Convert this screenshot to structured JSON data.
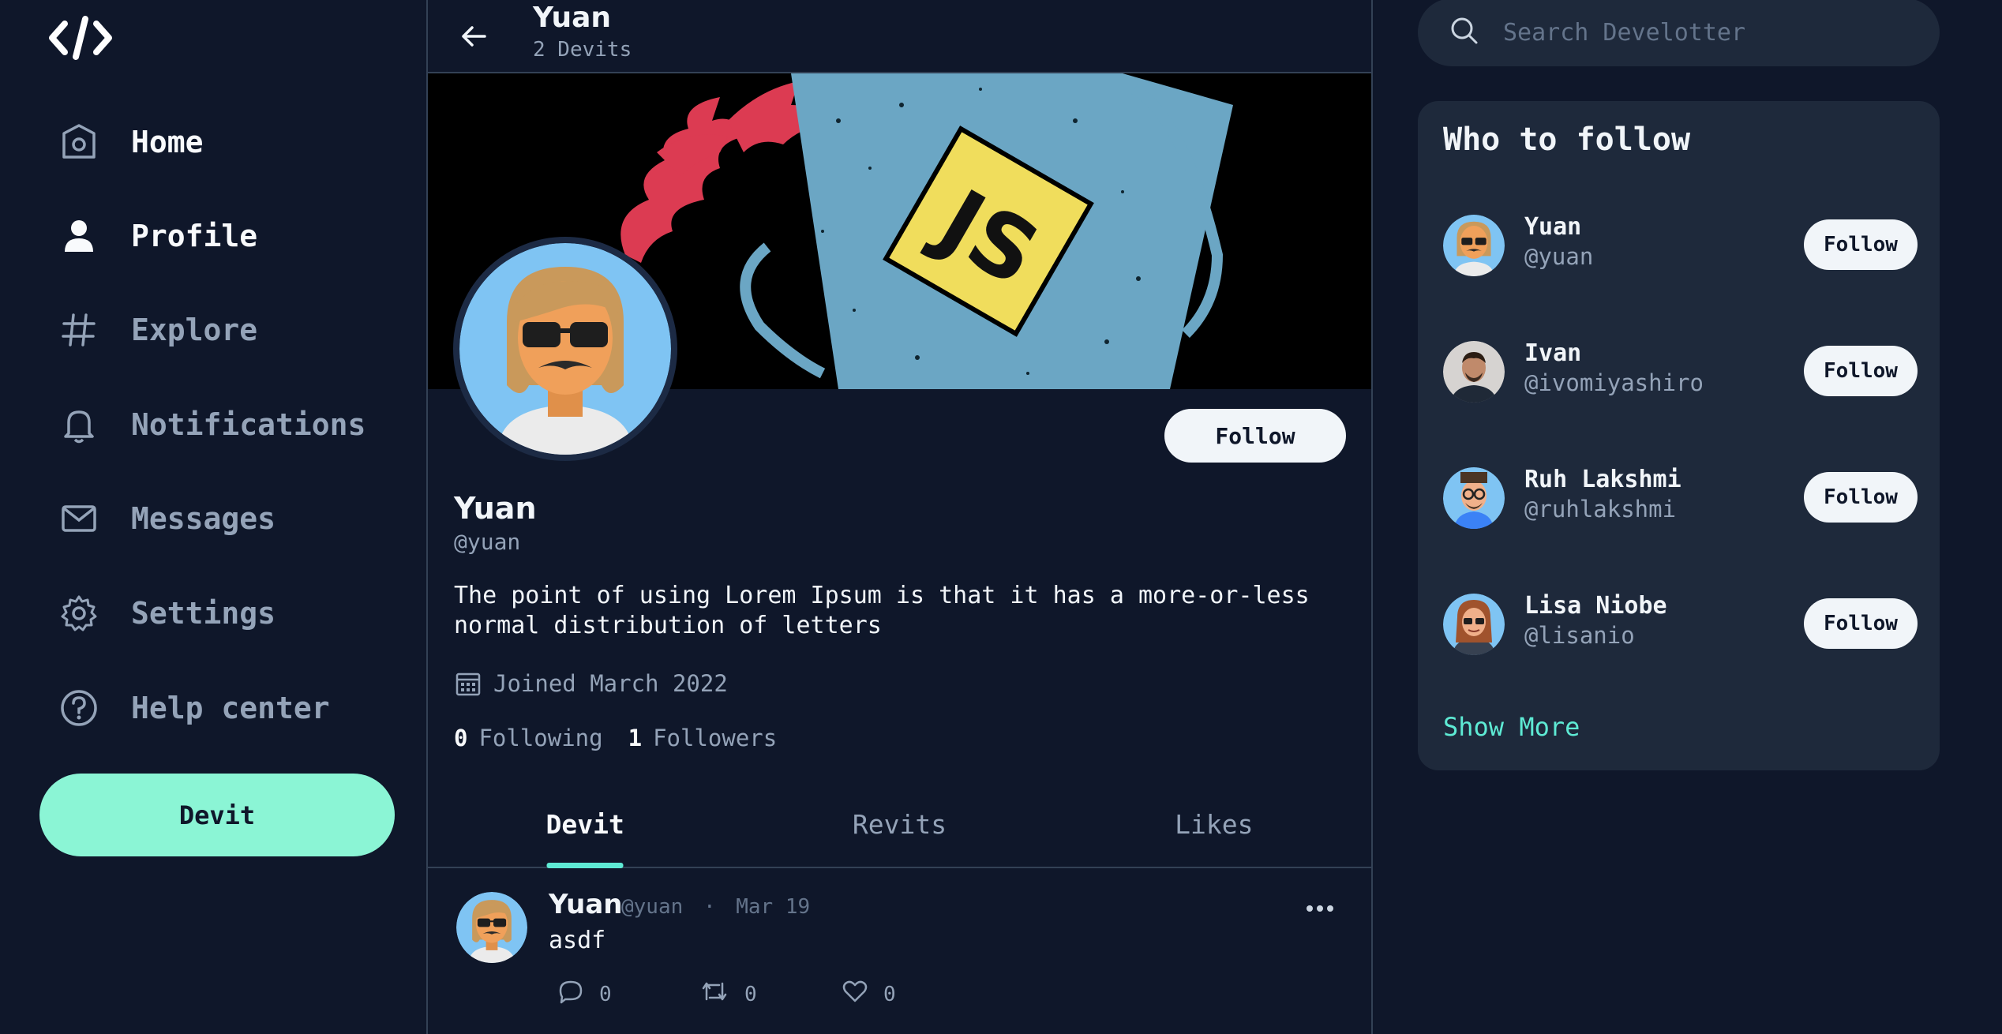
{
  "nav": {
    "items": [
      {
        "label": "Home",
        "icon": "home-icon"
      },
      {
        "label": "Profile",
        "icon": "user-icon"
      },
      {
        "label": "Explore",
        "icon": "hashtag-icon"
      },
      {
        "label": "Notifications",
        "icon": "bell-icon"
      },
      {
        "label": "Messages",
        "icon": "envelope-icon"
      },
      {
        "label": "Settings",
        "icon": "gear-icon"
      },
      {
        "label": "Help center",
        "icon": "help-icon"
      }
    ],
    "active": "Profile",
    "devit_label": "Devit"
  },
  "header": {
    "name": "Yuan",
    "count": "2 Devits"
  },
  "profile": {
    "name": "Yuan",
    "handle": "@yuan",
    "bio": "The point of using Lorem Ipsum is that it has a more-or-less normal distribution of letters",
    "joined": "Joined March 2022",
    "following_count": "0",
    "following_label": "Following",
    "followers_count": "1",
    "followers_label": "Followers",
    "follow_label": "Follow",
    "banner_text": "JS"
  },
  "tabs": [
    {
      "label": "Devit",
      "active": true
    },
    {
      "label": "Revits",
      "active": false
    },
    {
      "label": "Likes",
      "active": false
    }
  ],
  "post": {
    "name": "Yuan",
    "handle": "@yuan",
    "separator": "·",
    "date": "Mar 19",
    "text": "asdf",
    "replies": "0",
    "revits": "0",
    "likes": "0"
  },
  "search": {
    "placeholder": "Search Develotter"
  },
  "who_to_follow": {
    "title": "Who to follow",
    "users": [
      {
        "name": "Yuan",
        "handle": "@yuan",
        "follow": "Follow"
      },
      {
        "name": "Ivan",
        "handle": "@ivomiyashiro",
        "follow": "Follow"
      },
      {
        "name": "Ruh Lakshmi",
        "handle": "@ruhlakshmi",
        "follow": "Follow"
      },
      {
        "name": "Lisa Niobe",
        "handle": "@lisanio",
        "follow": "Follow"
      }
    ],
    "show_more": "Show More"
  },
  "colors": {
    "background": "#0f172a",
    "panel": "#1e293b",
    "accent": "#8bf5d5",
    "link": "#5eead4"
  }
}
